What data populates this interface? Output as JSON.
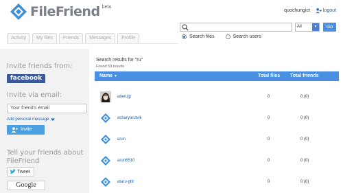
{
  "app": {
    "logo_text": "FileFriend",
    "beta_label": "beta",
    "brand_color": "#3d8fd8"
  },
  "user": {
    "username": "quochungict",
    "logout_label": "logout"
  },
  "tabs": [
    {
      "label": "Activity"
    },
    {
      "label": "My files"
    },
    {
      "label": "Friends"
    },
    {
      "label": "Messages"
    },
    {
      "label": "Profile"
    }
  ],
  "search": {
    "value": "",
    "placeholder": "",
    "scope_selected": "All",
    "go_label": "Go",
    "options": [
      {
        "label": "Search files",
        "checked": true
      },
      {
        "label": "Search users",
        "checked": false
      }
    ]
  },
  "sidebar": {
    "invite_friends_heading": "Invite friends from:",
    "facebook_label": "facebook",
    "invite_email_heading": "Invite via email:",
    "email_placeholder": "Your friend's email",
    "add_message_label": "Add personal message",
    "invite_button_label": "Invite",
    "tell_heading": "Tell your friends about FileFriend",
    "tweet_label": "Tweet",
    "google_label": "Google"
  },
  "results": {
    "title": "Search results for \"ru\"",
    "count_text": "Found 59 results",
    "columns": {
      "name": "Name",
      "total_files": "Total files",
      "total_friends": "Total friends"
    },
    "rows": [
      {
        "name": "aberujp",
        "files": "0",
        "friends": "0 (0)",
        "avatar": "photo"
      },
      {
        "name": "acharyarutvik",
        "files": "0",
        "friends": "0 (0)",
        "avatar": "default-logo"
      },
      {
        "name": "arun",
        "files": "0",
        "friends": "0 (0)",
        "avatar": "default-logo"
      },
      {
        "name": "arun6510",
        "files": "0",
        "friends": "0 (0)",
        "avatar": "default-logo"
      },
      {
        "name": "ataru-gttr",
        "files": "0",
        "friends": "0 (0)",
        "avatar": "default-logo"
      }
    ]
  }
}
